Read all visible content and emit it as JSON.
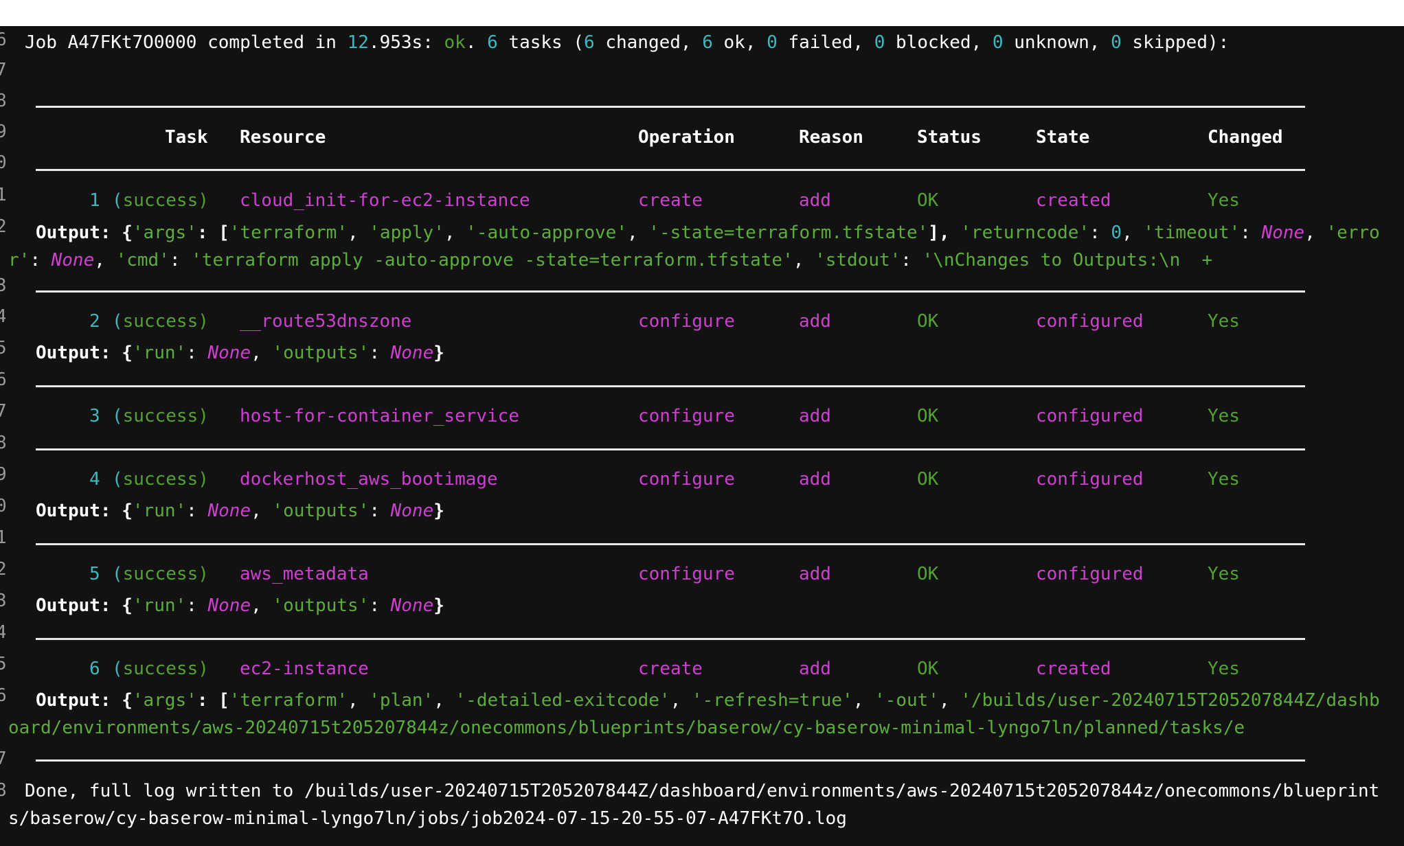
{
  "summary": {
    "prefix": "Job A47FKt7O0000 completed in ",
    "secs_int": "12",
    "secs_rest": ".953s: ",
    "ok": "ok",
    "dot": ". ",
    "tasks_n": "6",
    "tasks": " tasks (",
    "changed_n": "6",
    "changed": " changed, ",
    "ok_n": "6",
    "ok_t": " ok, ",
    "failed_n": "0",
    "failed": " failed, ",
    "blocked_n": "0",
    "blocked": " blocked, ",
    "unknown_n": "0",
    "unknown": " unknown, ",
    "skipped_n": "0",
    "skipped": " skipped):"
  },
  "gutter": [
    "6",
    "7",
    "8",
    "9",
    "0",
    "1",
    "2",
    "",
    "3",
    "4",
    "5",
    "6",
    "7",
    "8",
    "9",
    "0",
    "1",
    "2",
    "3",
    "4",
    "5",
    "6",
    "",
    "7",
    "8",
    ""
  ],
  "headers": {
    "task": "Task",
    "resource": "Resource",
    "operation": "Operation",
    "reason": "Reason",
    "status": "Status",
    "state": "State",
    "changed": "Changed"
  },
  "rows": [
    {
      "num": "1",
      "result": "(success)",
      "resource": "cloud_init-for-ec2-instance",
      "operation": "create",
      "reason": "add",
      "status": "OK",
      "state": "created",
      "changed": "Yes"
    },
    {
      "num": "2",
      "result": "(success)",
      "resource": "__route53dnszone",
      "operation": "configure",
      "reason": "add",
      "status": "OK",
      "state": "configured",
      "changed": "Yes"
    },
    {
      "num": "3",
      "result": "(success)",
      "resource": "host-for-container_service",
      "operation": "configure",
      "reason": "add",
      "status": "OK",
      "state": "configured",
      "changed": "Yes"
    },
    {
      "num": "4",
      "result": "(success)",
      "resource": "dockerhost_aws_bootimage",
      "operation": "configure",
      "reason": "add",
      "status": "OK",
      "state": "configured",
      "changed": "Yes"
    },
    {
      "num": "5",
      "result": "(success)",
      "resource": "aws_metadata",
      "operation": "configure",
      "reason": "add",
      "status": "OK",
      "state": "configured",
      "changed": "Yes"
    },
    {
      "num": "6",
      "result": "(success)",
      "resource": "ec2-instance",
      "operation": "create",
      "reason": "add",
      "status": "OK",
      "state": "created",
      "changed": "Yes"
    }
  ],
  "output1": {
    "label": "Output: ",
    "l1": [
      "{",
      "'args'",
      ": [",
      "'terraform'",
      ", ",
      "'apply'",
      ", ",
      "'-auto-approve'",
      ", ",
      "'-state=terraform.tfstate'",
      "], ",
      "'returncode'",
      ": ",
      "0",
      ", ",
      "'timeout'",
      ": ",
      "None",
      ", ",
      "'erro"
    ],
    "l2": [
      "r'",
      ": ",
      "None",
      ", ",
      "'cmd'",
      ": ",
      "'terraform apply -auto-approve -state=terraform.tfstate'",
      ", ",
      "'stdout'",
      ": ",
      "'\\nChanges to Outputs:\\n  +"
    ]
  },
  "output_run": {
    "label": "Output: ",
    "parts": [
      "{",
      "'run'",
      ": ",
      "None",
      ", ",
      "'outputs'",
      ": ",
      "None",
      "}"
    ]
  },
  "output6": {
    "label": "Output: ",
    "l1": [
      "{",
      "'args'",
      ": [",
      "'terraform'",
      ", ",
      "'plan'",
      ", ",
      "'-detailed-exitcode'",
      ", ",
      "'-refresh=true'",
      ", ",
      "'-out'",
      ", ",
      "'/builds/user-20240715T205207844Z/dashb"
    ],
    "l2": "oard/environments/aws-20240715t205207844z/onecommons/blueprints/baserow/cy-baserow-minimal-lyngo7ln/planned/tasks/e"
  },
  "done": {
    "l1": "Done, full log written to /builds/user-20240715T205207844Z/dashboard/environments/aws-20240715t205207844z/onecommons/blueprint",
    "l2": "s/baserow/cy-baserow-minimal-lyngo7ln/jobs/job2024-07-15-20-55-07-A47FKt7O.log"
  }
}
